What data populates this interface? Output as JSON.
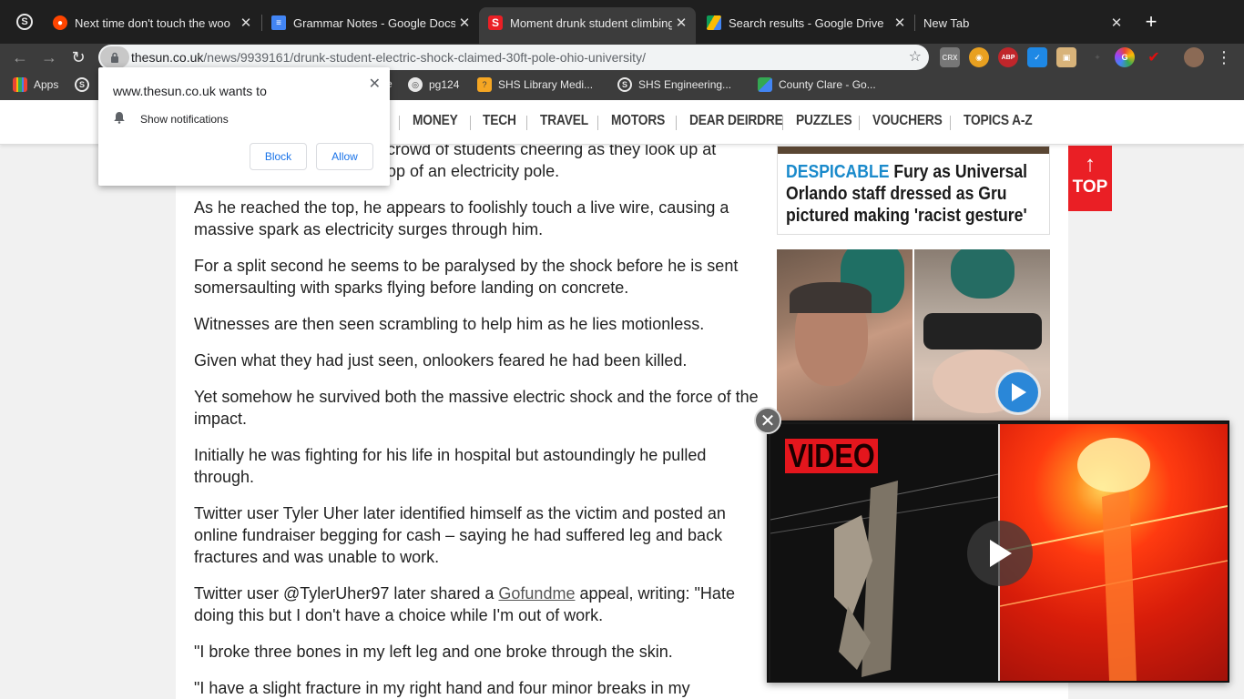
{
  "browser": {
    "tabs": [
      {
        "title": "Next time don't touch the woo",
        "icon": "reddit-icon",
        "active": false
      },
      {
        "title": "Grammar Notes - Google Docs",
        "icon": "google-docs-icon",
        "active": false
      },
      {
        "title": "Moment drunk student climbing",
        "icon": "the-sun-icon",
        "active": true
      },
      {
        "title": "Search results - Google Drive",
        "icon": "google-drive-icon",
        "active": false
      },
      {
        "title": "New Tab",
        "icon": "",
        "active": false
      }
    ],
    "url_domain": "thesun.co.uk",
    "url_path": "/news/9939161/drunk-student-electric-shock-claimed-30ft-pole-ohio-university/",
    "bookmarks": [
      {
        "label": "Apps"
      },
      {
        "label": "e"
      },
      {
        "label": "pg124"
      },
      {
        "label": "SHS Library Medi..."
      },
      {
        "label": "SHS Engineering..."
      },
      {
        "label": "County Clare - Go..."
      }
    ],
    "ext_badge_count": "11"
  },
  "notification": {
    "site_text": "www.thesun.co.uk wants to",
    "permission": "Show notifications",
    "block_label": "Block",
    "allow_label": "Allow"
  },
  "site_nav": [
    "MONEY",
    "TECH",
    "TRAVEL",
    "MOTORS",
    "DEAR DEIRDRE",
    "PUZZLES",
    "VOUCHERS",
    "TOPICS A-Z"
  ],
  "article": {
    "paragraphs": [
      {
        "text": "crowd of students cheering as they look up at\nop of an electricity pole."
      },
      {
        "text": "As he reached the top, he appears to foolishly touch a live wire, causing a massive spark as electricity surges through him."
      },
      {
        "text": "For a split second he seems to be paralysed by the shock before he is sent somersaulting with sparks flying before landing on concrete."
      },
      {
        "text": "Witnesses are then seen scrambling to help him as he lies motionless."
      },
      {
        "text": "Given what they had just seen, onlookers feared he had been killed."
      },
      {
        "text": "Yet somehow he survived both the massive electric shock and the force of the impact."
      },
      {
        "text": "Initially he was fighting for his life in hospital but astoundingly he pulled through."
      },
      {
        "text": "Twitter user Tyler Uher later identified himself as the victim and posted an online fundraiser begging for cash – saying he had suffered leg and back fractures and was unable to work."
      },
      {
        "text_before": "Twitter user @TylerUher97 later shared a ",
        "link": "Gofundme",
        "text_after": " appeal, writing: \"Hate doing this but I don't have a choice while I'm out of work."
      },
      {
        "text": "\"I broke three bones in my left leg and one broke through the skin."
      },
      {
        "text": "\"I have a slight fracture in my right hand and four minor breaks in my"
      }
    ]
  },
  "sidebar": {
    "kicker": "DESPICABLE",
    "headline": "Fury as Universal Orlando staff dressed as Gru pictured making 'racist gesture'",
    "top_label": "TOP"
  },
  "video": {
    "badge": "VIDEO"
  },
  "colors": {
    "sun_red": "#ea1f25",
    "kicker_blue": "#1a8acb",
    "link_blue": "#1a73e8"
  }
}
